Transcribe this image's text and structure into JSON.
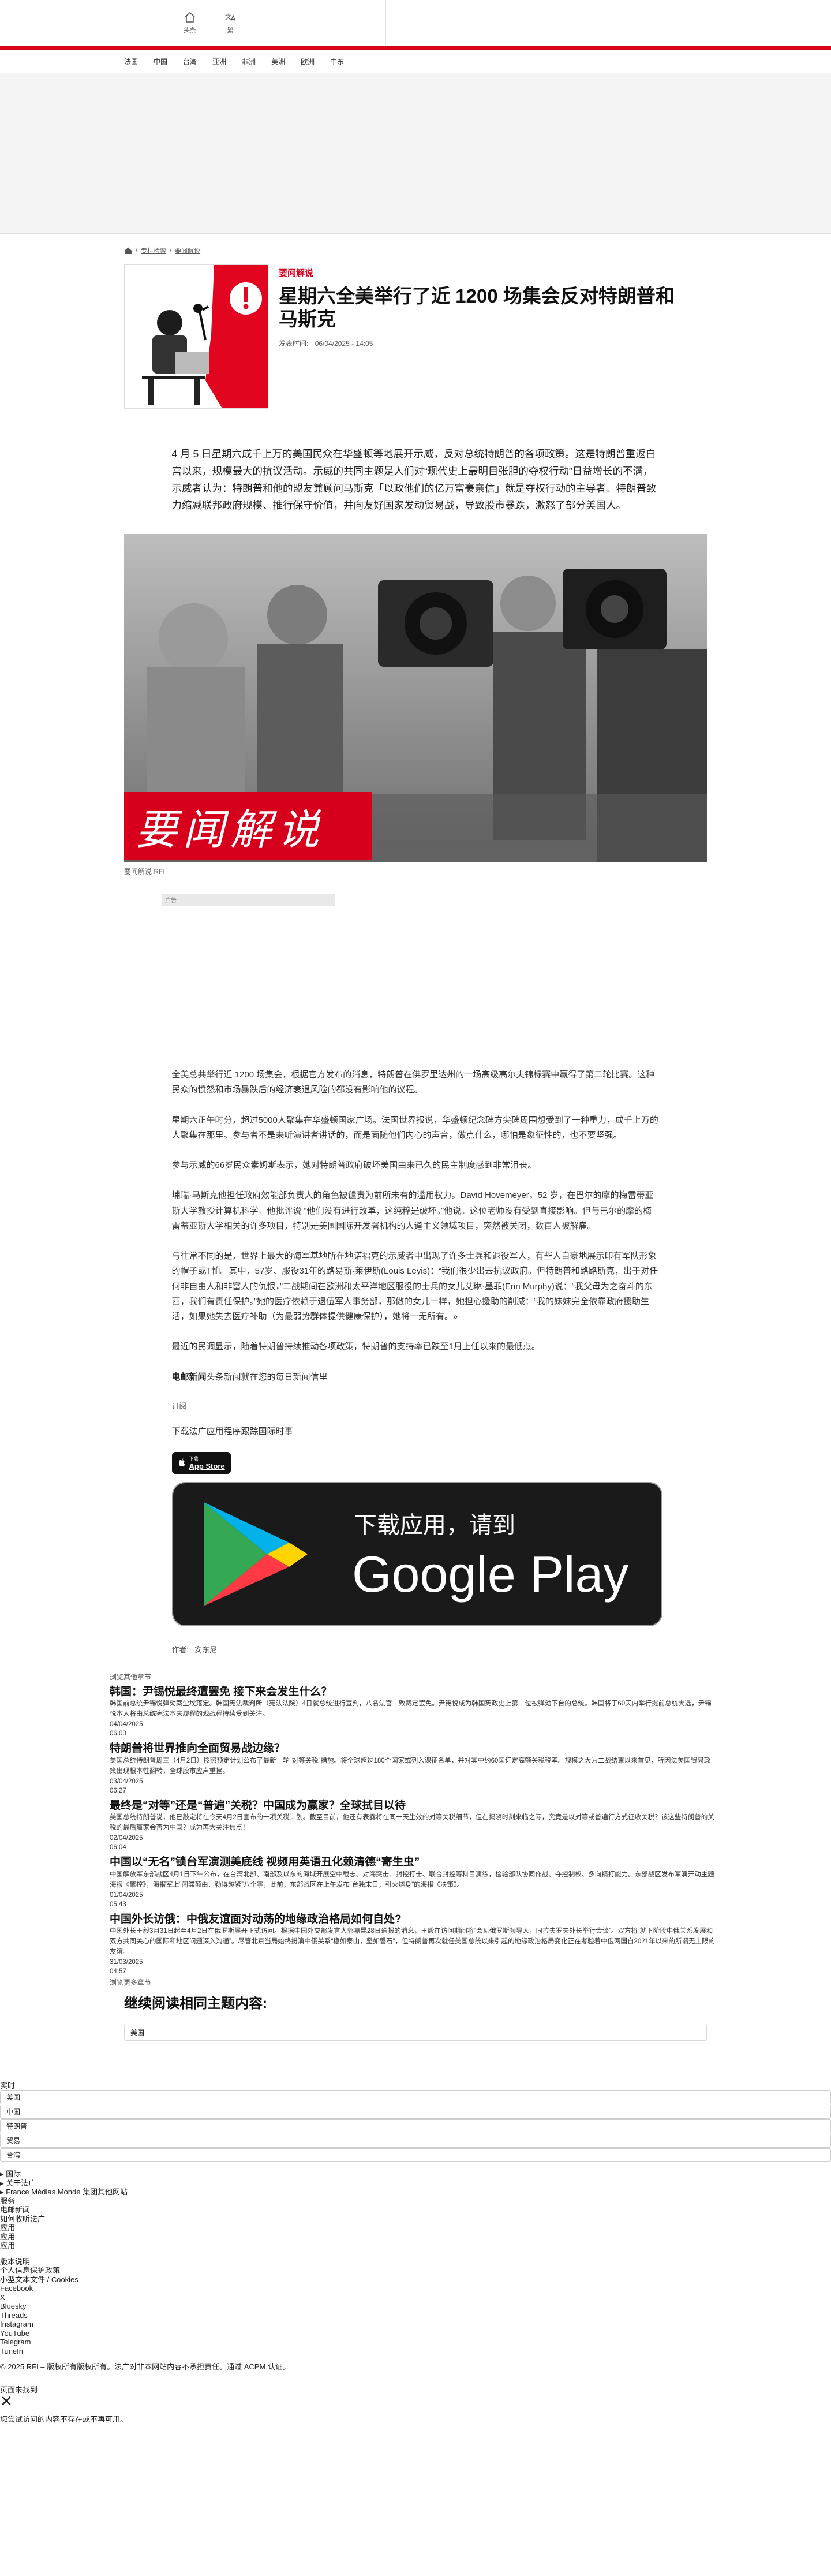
{
  "header": {
    "nav_icons": [
      {
        "label": "头条",
        "icon": "home-icon"
      },
      {
        "label": "繁",
        "icon": "translate-icon"
      }
    ]
  },
  "secnav": [
    "法国",
    "中国",
    "台湾",
    "亚洲",
    "非洲",
    "美洲",
    "欧洲",
    "中东"
  ],
  "breadcrumb": {
    "items": [
      "专栏检索",
      "要闻解说"
    ]
  },
  "article": {
    "kicker": "要闻解说",
    "title": "星期六全美举行了近 1200 场集会反对特朗普和马斯克",
    "date_label": "发表时间:",
    "date": "06/04/2025 - 14:05",
    "lede": "4 月 5 日星期六成千上万的美国民众在华盛顿等地展开示威，反对总统特朗普的各项政策。这是特朗普重返白宫以来，规模最大的抗议活动。示威的共同主题是人们对“现代史上最明目张胆的夺权行动”日益增长的不满，示威者认为：特朗普和他的盟友兼顾问马斯克「以政他们的亿万富豪亲信」就是夺权行动的主导者。特朗普致力缩减联邦政府规模、推行保守价值，并向友好国家发动贸易战，导致股市暴跌，激怒了部分美国人。",
    "hero_overlay": "要闻解说",
    "hero_caption": "要闻解说 RFI",
    "ad_label": "广告",
    "paragraphs": [
      "全美总共举行近 1200 场集会，根据官方发布的消息，特朗普在佛罗里达州的一场高级高尔夫锦标赛中赢得了第二轮比赛。这种民众的愤怒和市场暴跌后的经济衰退风险的都没有影响他的议程。",
      "星期六正午时分，超过5000人聚集在华盛顿国家广场。法国世界报说，华盛顿纪念碑方尖碑周围想受到了一种重力，成千上万的人聚集在那里。参与者不是来听演讲者讲话的，而是面随他们内心的声音，做点什么，哪怕是象征性的，也不要坚强。",
      "参与示威的66岁民众素姆斯表示，她对特朗普政府破坏美国由来已久的民主制度感到非常沮丧。",
      "埔瑞·马斯克他担任政府效能部负责人的角色被谴责为前所未有的滥用权力。David Hovemeyer，52 岁，在巴尔的摩的梅雷蒂亚斯大学教授计算机科学。他批评说 “他们没有进行改革，这纯粹是破坏。”他说。这位老师没有受到直接影响。但与巴尔的摩的梅雷蒂亚斯大学相关的许多项目，特别是美国国际开发署机构的人道主义领域项目，突然被关闭，数百人被解雇。",
      "与往常不同的是，世界上最大的海军基地所在地诺福克的示威者中出现了许多士兵和退役军人，有些人自豪地展示印有军队形象的帽子或T恤。其中，57岁、服役31年的路易斯·莱伊斯(Louis Leyis)：“我们很少出去抗议政府。但特朗普和路路斯克，出于对任何非自由人和非富人的仇恨，”二战期间在欧洲和太平洋地区服役的士兵的女儿艾琳·墨菲(Erin Murphy)说：“我父母为之奋斗的东西，我们有责任保护。”她的医疗依赖于退伍军人事务部，那傲的女儿一样，她担心援助的削减：“我的妹妹完全依靠政府援助生活，如果她失去医疗补助（为最弱势群体提供健康保护），她将一无所有。»",
      "最近的民调显示，随着特朗普持续推动各项政策，特朗普的支持率已跌至1月上任以来的最低点。"
    ],
    "brand_bold": "电邮新闻",
    "brand_rest": "头条新闻就在您的每日新闻信里",
    "subscribe": "订阅",
    "app_prompt": "下载法广应用程序跟踪国际时事",
    "app_store": {
      "sub": "下载",
      "main": "App Store"
    },
    "gplay": {
      "line1": "下载应用，请到",
      "line2": "Google Play"
    },
    "author_label": "作者:",
    "author_name": "安东尼"
  },
  "related": {
    "header": "浏览其他章节",
    "items": [
      {
        "title": "韩国：尹锡悦最终遭罢免 接下来会发生什么？",
        "summary": "韩国前总统尹锡悦弹劾案尘埃落定。韩国宪法裁判所（宪法法院）4日就总统进行宣判，八名法官一致裁定罢免。尹锡悦成为韩国宪政史上第二位被弹劾下台的总统。韩国将于60天内举行提前总统大选，尹锡悦本人将由总统宪法本来履程的观战程持续受到关注。",
        "date": "04/04/2025",
        "time": "06:00"
      },
      {
        "title": "特朗普将世界推向全面贸易战边缘？",
        "summary": "美国总统特朗普周三（4月2日）按照预定计划公布了最新一轮“对等关税”措施。将全球超过180个国家或列入课征名单，并对其中约60国订定高额关税税率。规模之大为二战结束以来首见，所因法美国贸易政策出现根本性翻转，全球股市应声重挫。",
        "date": "03/04/2025",
        "time": "06:27"
      },
      {
        "title": "最终是“对等”还是“普遍”关税？中国成为赢家？全球拭目以待",
        "summary": "美国总统特朗普说，他已敲定将在今天4月2日宣布的一项关税计划。截至目前，他还有表露将在同一天生效的对等关税细节，但在揭晓时刻来临之际，究竟是以对等或普遍行方式征收关税？该这些特朗普的关税的最后赢家会否为中国？成为再大关注焦点！",
        "date": "02/04/2025",
        "time": "06:04"
      },
      {
        "title": "中国以“无名”锁台军演测美底线 视频用英语丑化赖清德“寄生虫”",
        "summary": "中国解放军东部战区4月1日下午公布，在台湾北部、南部及以东的海域开展空中载志、对海突击、封控打击、联合封控等科目演练，检验部队协同作战、夺控制权、多向精打能力。东部战区发布军演开动主题海报《擎控》，海报军上“闯滞颠由、勒得越紧”八个字，此前，东部战区在上午发布“台独末日，引火烧身”的海报《决策》。",
        "date": "01/04/2025",
        "time": "05:43"
      },
      {
        "title": "中国外长访俄：中俄友谊面对动荡的地缘政治格局如何自处?",
        "summary": "中国外长王毅3月31日起至4月2日在俄罗斯展开正式访问。根据中国外交部发言人郭嘉昆28日通报的消息，王毅在访问期间将“会见俄罗斯领导人，同拉夫罗夫外长举行会谈”。双方将“就下阶段中俄关系发展和双方共同关心的国际和地区问题深入沟通”。尽管北京当局始终扮演中俄关系“稳如泰山，坚如磐石”，但特朗普再次就任美国总统以来引起的地缘政治格局变化正在考验着中俄两国自2021年以来的所谓无上限的友谊。",
        "date": "31/03/2025",
        "time": "04:57"
      }
    ],
    "more": "浏览更多章节"
  },
  "continue": {
    "title": "继续阅读相同主题内容:",
    "tag": "美国"
  },
  "footer": {
    "realtime_label": "实时",
    "pills": [
      "美国",
      "中国",
      "特朗普",
      "贸易",
      "台湾"
    ],
    "menu_lines": [
      "▸ 国际",
      "▸ 关于法广",
      "▸ France Médias Monde 集团其他网站"
    ],
    "lines_a": [
      "服务",
      "电邮新闻",
      "如何收听法广",
      "应用",
      "应用",
      "应用"
    ],
    "lines_b": [
      "版本说明",
      "个人信息保护政策",
      "小型文本文件 / Cookies",
      "Facebook",
      "X",
      "Bluesky",
      "Threads",
      "Instagram",
      "YouTube",
      "Telegram",
      "TuneIn"
    ],
    "copyright": "© 2025 RFI – 版权所有版权所有。法广对非本网站内容不承担责任。通过 ACPM 认证。",
    "not_found": "页面未找到",
    "missing": "您尝试访问的内容不存在或不再可用。"
  },
  "colors": {
    "brand_red": "#d6001c",
    "ad_gray": "#f4f4f4"
  }
}
